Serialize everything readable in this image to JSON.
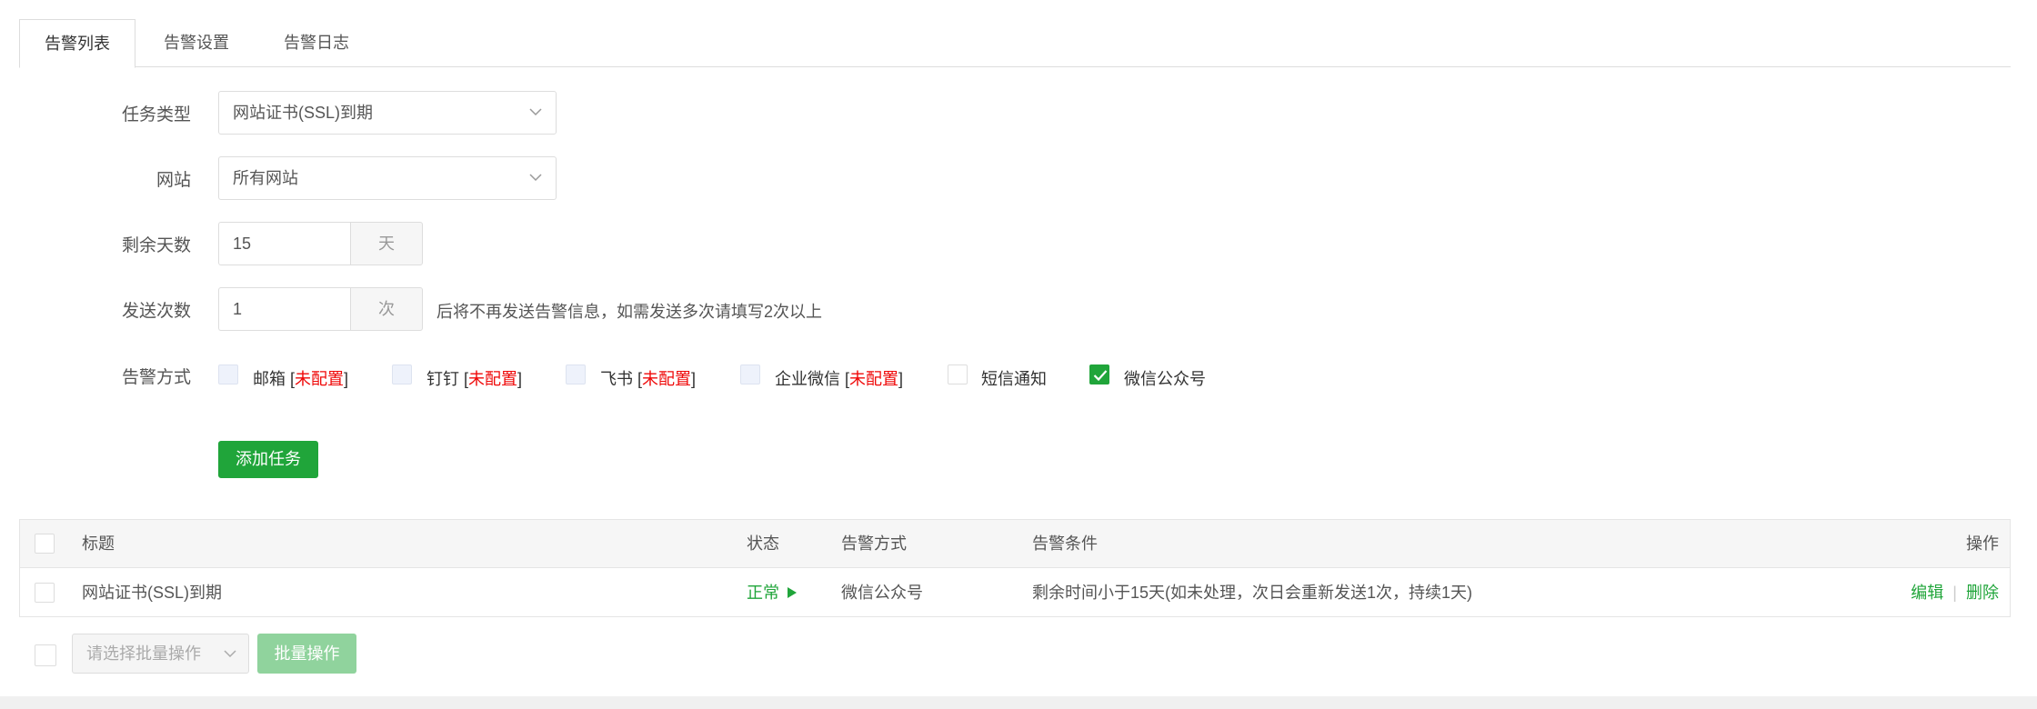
{
  "tabs": [
    {
      "label": "告警列表",
      "active": true
    },
    {
      "label": "告警设置",
      "active": false
    },
    {
      "label": "告警日志",
      "active": false
    }
  ],
  "form": {
    "task_type": {
      "label": "任务类型",
      "value": "网站证书(SSL)到期"
    },
    "site": {
      "label": "网站",
      "value": "所有网站"
    },
    "days_left": {
      "label": "剩余天数",
      "value": "15",
      "unit": "天"
    },
    "send_count": {
      "label": "发送次数",
      "value": "1",
      "unit": "次",
      "hint": "后将不再发送告警信息，如需发送多次请填写2次以上"
    },
    "methods_label": "告警方式",
    "methods": [
      {
        "name": "邮箱",
        "status": "未配置",
        "state": "disabled"
      },
      {
        "name": "钉钉",
        "status": "未配置",
        "state": "disabled"
      },
      {
        "name": "飞书",
        "status": "未配置",
        "state": "disabled"
      },
      {
        "name": "企业微信",
        "status": "未配置",
        "state": "disabled"
      },
      {
        "name": "短信通知",
        "status": "",
        "state": "unchecked"
      },
      {
        "name": "微信公众号",
        "status": "",
        "state": "checked"
      }
    ],
    "add_button": "添加任务"
  },
  "table": {
    "headers": {
      "title": "标题",
      "status": "状态",
      "method": "告警方式",
      "condition": "告警条件",
      "action": "操作"
    },
    "rows": [
      {
        "title": "网站证书(SSL)到期",
        "status": "正常",
        "method": "微信公众号",
        "condition": "剩余时间小于15天(如未处理，次日会重新发送1次，持续1天)",
        "edit": "编辑",
        "delete": "删除"
      }
    ]
  },
  "footer": {
    "batch_placeholder": "请选择批量操作",
    "batch_button": "批量操作"
  },
  "colors": {
    "accent": "#20a53a",
    "warning": "#ef0808"
  }
}
